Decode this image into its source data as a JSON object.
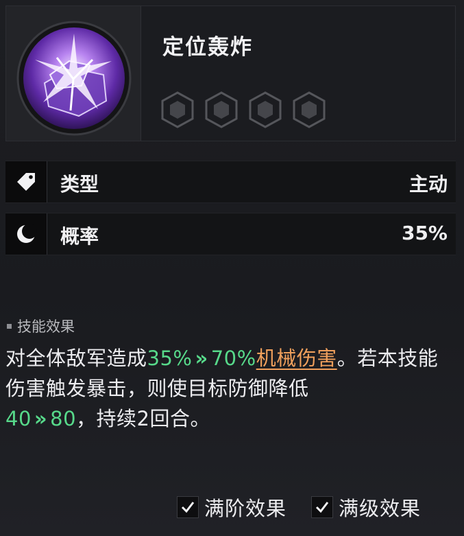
{
  "skill": {
    "name": "定位轰炸",
    "icon": "cracked-crystal-explosion-icon",
    "star_slots": 4,
    "accent_color": "#8a4fd6"
  },
  "stats": {
    "type": {
      "icon": "tag-icon",
      "label": "类型",
      "value": "主动"
    },
    "rate": {
      "icon": "moon-icon",
      "label": "概率",
      "value": "35%"
    }
  },
  "effect": {
    "title": "技能效果",
    "segments": {
      "s1": "对全体敌军造成",
      "dmg_from": "35%",
      "arrow1": "»",
      "dmg_to": "70%",
      "dmg_type": "机械伤害",
      "s2": "。若本技能伤害触发暴击，则使目标防御降低",
      "def_from": "40",
      "arrow2": "»",
      "def_to": "80",
      "s3": "，持续2回合。"
    },
    "colors": {
      "green": "#57d98a",
      "orange": "#f0a05c"
    }
  },
  "toggles": {
    "max_rank": {
      "label": "满阶效果",
      "checked": true
    },
    "max_level": {
      "label": "满级效果",
      "checked": true
    }
  }
}
